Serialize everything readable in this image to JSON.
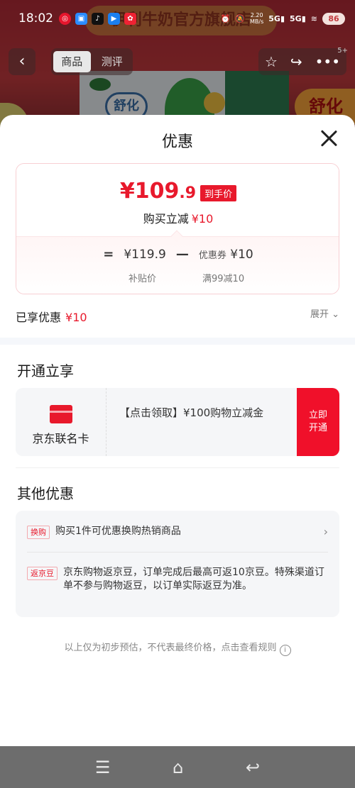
{
  "status_bar": {
    "time": "18:02",
    "net_speed_top": "2.20",
    "net_speed_bottom": "MB/s",
    "signal_1": "5G",
    "signal_2": "5G",
    "battery": "86"
  },
  "background": {
    "banner_text": "伊利牛奶官方旗舰店",
    "product_label": "舒化",
    "badge_text": "舒化"
  },
  "nav": {
    "back_icon": "chevron-left-icon",
    "tabs": [
      {
        "label": "商品",
        "active": true
      },
      {
        "label": "测评",
        "active": false
      }
    ],
    "notification_count": "5+"
  },
  "sheet": {
    "title": "优惠",
    "price": {
      "currency": "¥",
      "amount_main": "109",
      "amount_decimal": ".9",
      "tag": "到手价",
      "buy_reduce_label": "购买立减",
      "buy_reduce_value": "¥10",
      "formula": {
        "equals": "=",
        "base_price": "¥119.9",
        "minus": "—",
        "coupon_label": "优惠券",
        "coupon_value": "¥10",
        "base_price_label": "补贴价",
        "coupon_condition": "满99减10"
      }
    },
    "enjoyed_label": "已享优惠",
    "enjoyed_value": "¥10",
    "expand_label": "展开",
    "open_section": {
      "title": "开通立享",
      "card_name": "京东联名卡",
      "card_desc": "【点击领取】¥100购物立减金",
      "cta": "立即开通"
    },
    "other_section": {
      "title": "其他优惠",
      "items": [
        {
          "tag": "换购",
          "text": "购买1件可优惠换购热销商品"
        },
        {
          "tag": "返京豆",
          "text": "京东购物返京豆，订单完成后最高可返10京豆。特殊渠道订单不参与购物返豆，以订单实际返豆为准。"
        }
      ]
    },
    "footnote": "以上仅为初步预估，不代表最终价格，点击查看规则"
  },
  "colors": {
    "accent_red": "#e8192c",
    "cta_red": "#f0102a"
  }
}
